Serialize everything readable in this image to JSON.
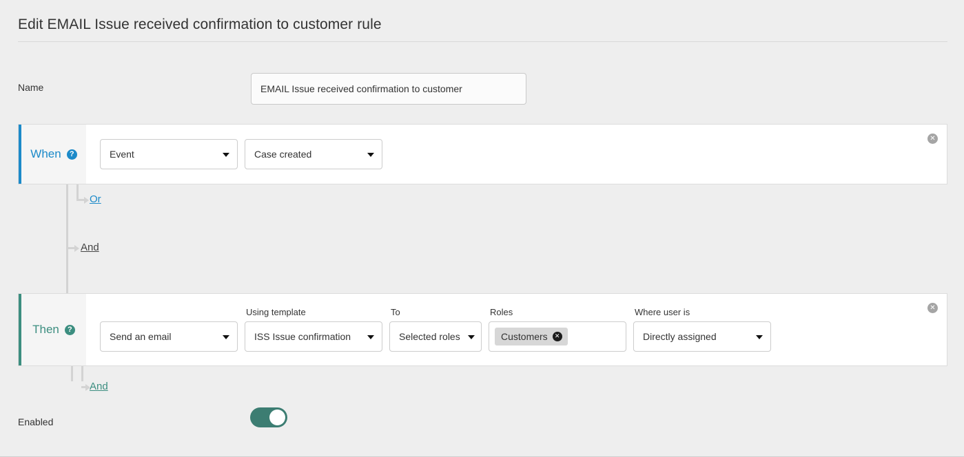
{
  "page": {
    "title": "Edit EMAIL Issue received confirmation to customer rule"
  },
  "name_field": {
    "label": "Name",
    "value": "EMAIL Issue received confirmation to customer",
    "placeholder": "Name"
  },
  "when_block": {
    "label": "When",
    "help_icon": "question-mark-icon",
    "close_icon": "remove-block-icon",
    "event_type": {
      "label": "",
      "value": "Event"
    },
    "trigger": {
      "label": "",
      "value": "Case created"
    }
  },
  "connectors": {
    "or": "Or",
    "and_middle": "And",
    "and_bottom": "And"
  },
  "then_block": {
    "label": "Then",
    "help_icon": "question-mark-icon",
    "close_icon": "remove-block-icon",
    "action": {
      "label": "",
      "value": "Send an email"
    },
    "template": {
      "label": "Using template",
      "value": "ISS Issue confirmation"
    },
    "to": {
      "label": "To",
      "value": "Selected roles"
    },
    "roles": {
      "label": "Roles",
      "tags": [
        {
          "text": "Customers",
          "remove_icon": "remove-tag-icon"
        }
      ]
    },
    "where_user_is": {
      "label": "Where user is",
      "value": "Directly assigned"
    }
  },
  "enabled": {
    "label": "Enabled",
    "state": "on"
  },
  "colors": {
    "when_accent": "#1c8ac9",
    "then_accent": "#3c8e80",
    "toggle_on": "#3c7d72",
    "page_background": "#eeeeee"
  }
}
